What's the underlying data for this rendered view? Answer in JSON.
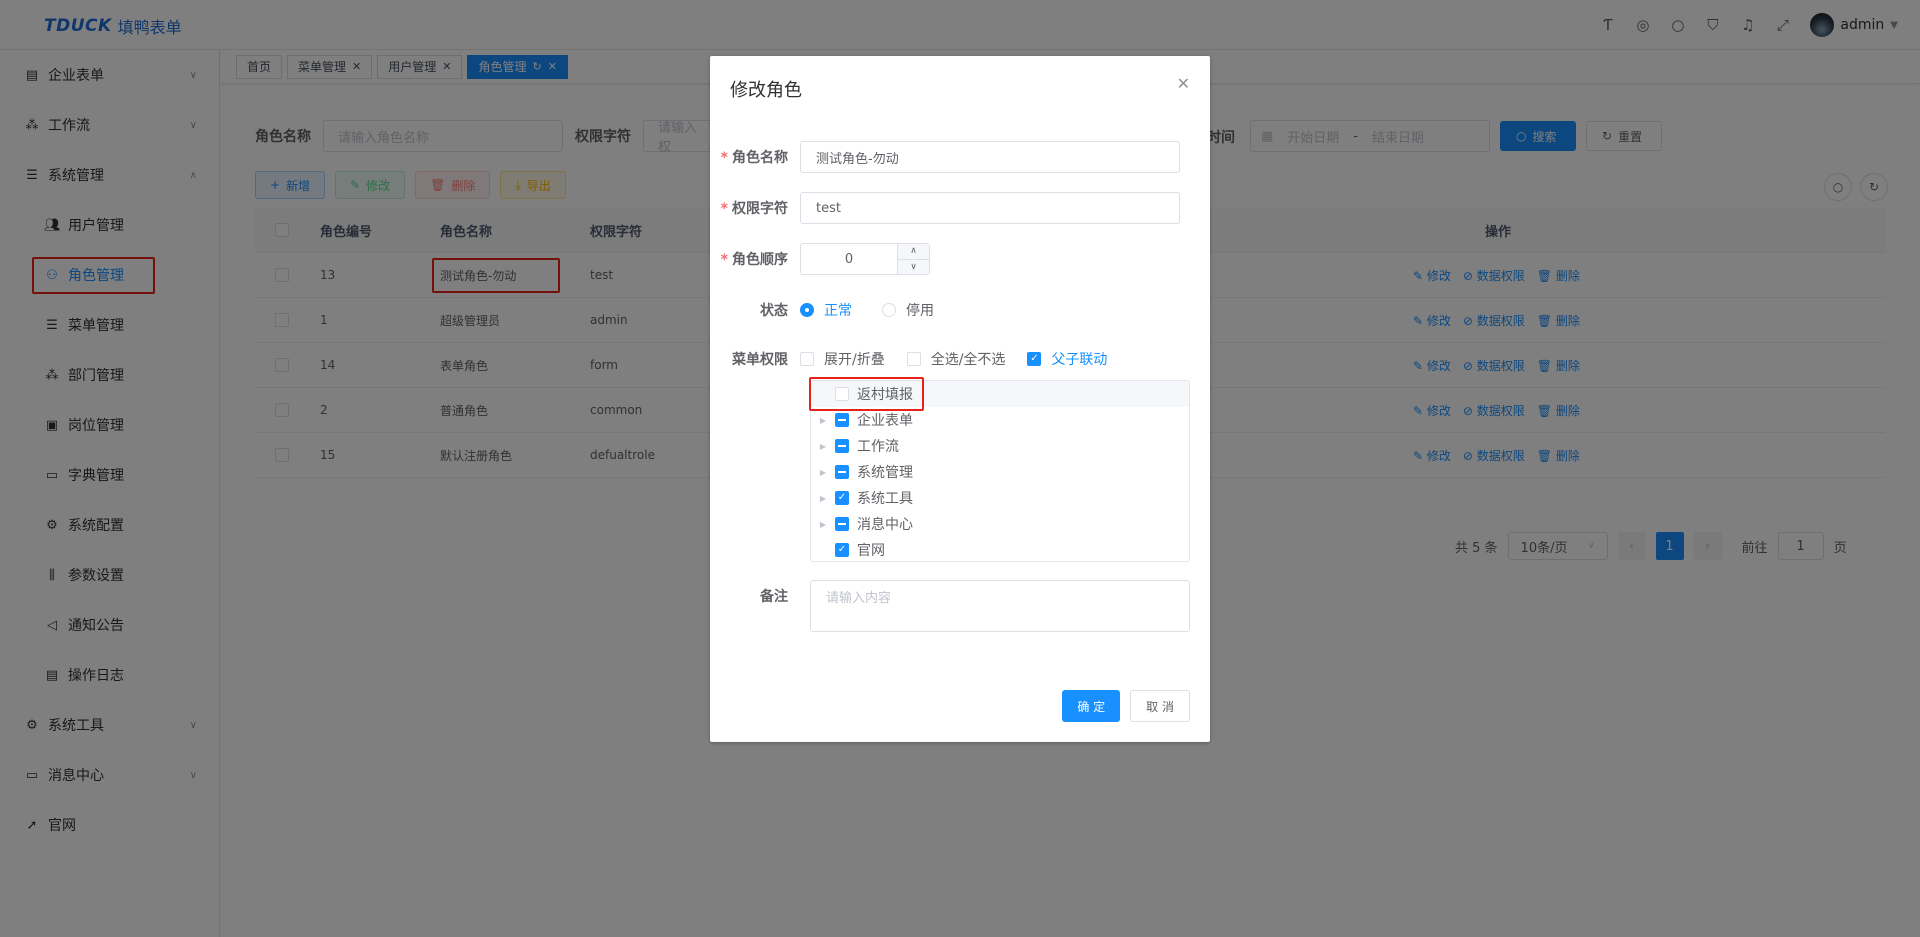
{
  "header": {
    "brand": "TDUCK",
    "brand_cn": "填鸭表单",
    "user": "admin"
  },
  "sidebar": {
    "items": [
      {
        "label": "企业表单",
        "icon": "building-icon",
        "expandable": true
      },
      {
        "label": "工作流",
        "icon": "flow-icon",
        "expandable": true
      },
      {
        "label": "系统管理",
        "icon": "list-icon",
        "expandable": true,
        "expanded": true
      },
      {
        "label": "系统工具",
        "icon": "tool-icon",
        "expandable": true
      },
      {
        "label": "消息中心",
        "icon": "message-icon",
        "expandable": true
      },
      {
        "label": "官网",
        "icon": "send-icon",
        "expandable": false
      }
    ],
    "sub_items": [
      {
        "label": "用户管理",
        "icon": "users-icon"
      },
      {
        "label": "角色管理",
        "icon": "role-icon",
        "active": true
      },
      {
        "label": "菜单管理",
        "icon": "menu-icon"
      },
      {
        "label": "部门管理",
        "icon": "tree-icon"
      },
      {
        "label": "岗位管理",
        "icon": "post-icon"
      },
      {
        "label": "字典管理",
        "icon": "dict-icon"
      },
      {
        "label": "系统配置",
        "icon": "config-icon"
      },
      {
        "label": "参数设置",
        "icon": "sliders-icon"
      },
      {
        "label": "通知公告",
        "icon": "speaker-icon"
      },
      {
        "label": "操作日志",
        "icon": "log-icon"
      }
    ]
  },
  "tags": [
    {
      "label": "首页",
      "closable": false,
      "active": false
    },
    {
      "label": "菜单管理",
      "closable": true,
      "active": false
    },
    {
      "label": "用户管理",
      "closable": true,
      "active": false
    },
    {
      "label": "角色管理",
      "closable": true,
      "active": true
    }
  ],
  "search": {
    "role_name_label": "角色名称",
    "role_name_placeholder": "请输入角色名称",
    "perm_label": "权限字符",
    "perm_placeholder": "请输入权",
    "time_label": "时间",
    "start_placeholder": "开始日期",
    "range_sep": "-",
    "end_placeholder": "结束日期",
    "search_btn": "搜索",
    "reset_btn": "重置"
  },
  "toolbar": {
    "add": "新增",
    "edit": "修改",
    "delete": "删除",
    "export": "导出"
  },
  "table": {
    "headers": [
      "角色编号",
      "角色名称",
      "权限字符",
      "操作"
    ],
    "rows": [
      {
        "id": "13",
        "name": "测试角色-勿动",
        "key": "test"
      },
      {
        "id": "1",
        "name": "超级管理员",
        "key": "admin"
      },
      {
        "id": "14",
        "name": "表单角色",
        "key": "form"
      },
      {
        "id": "2",
        "name": "普通角色",
        "key": "common"
      },
      {
        "id": "15",
        "name": "默认注册角色",
        "key": "defualtrole"
      }
    ],
    "ops": {
      "edit": "修改",
      "data_perm": "数据权限",
      "delete": "删除"
    }
  },
  "pagination": {
    "total": "共 5 条",
    "page_size": "10条/页",
    "current": "1",
    "goto_label": "前往",
    "goto_value": "1",
    "page_unit": "页"
  },
  "dialog": {
    "title": "修改角色",
    "role_name_label": "角色名称",
    "role_name_value": "测试角色-勿动",
    "perm_label": "权限字符",
    "perm_value": "test",
    "order_label": "角色顺序",
    "order_value": "0",
    "status_label": "状态",
    "status_normal": "正常",
    "status_disabled": "停用",
    "menu_perm_label": "菜单权限",
    "expand_collapse": "展开/折叠",
    "select_all": "全选/全不选",
    "parent_child_link": "父子联动",
    "tree": [
      {
        "label": "返村填报",
        "state": "unchecked",
        "has_children": false
      },
      {
        "label": "企业表单",
        "state": "indeterminate",
        "has_children": true
      },
      {
        "label": "工作流",
        "state": "indeterminate",
        "has_children": true
      },
      {
        "label": "系统管理",
        "state": "indeterminate",
        "has_children": true
      },
      {
        "label": "系统工具",
        "state": "checked",
        "has_children": true
      },
      {
        "label": "消息中心",
        "state": "indeterminate",
        "has_children": true
      },
      {
        "label": "官网",
        "state": "checked",
        "has_children": false
      }
    ],
    "remark_label": "备注",
    "remark_placeholder": "请输入内容",
    "ok": "确 定",
    "cancel": "取 消"
  },
  "colors": {
    "primary": "#1890ff",
    "brand": "#1f6fd6",
    "highlight_box": "#e6231b"
  }
}
